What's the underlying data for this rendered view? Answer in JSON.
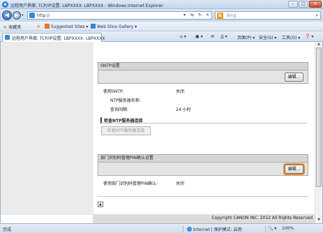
{
  "window": {
    "title": "远程用户界面: TCP/IP设置: LBPXXXX: LBPXXXX - Windows Internet Explorer",
    "minimize": "–",
    "maximize": "□",
    "close": "✕"
  },
  "address_bar": {
    "url": "http://",
    "search_placeholder": "Bing",
    "back_glyph": "◀",
    "forward_glyph": "▶",
    "refresh_glyph": "↻",
    "stop_glyph": "✕",
    "search_glyph": "⌕"
  },
  "favorites_bar": {
    "favorites": "收藏夹",
    "suggested_sites": "Suggested Sites ▾",
    "web_slice_gallery": "Web Slice Gallery ▾"
  },
  "tab": {
    "label": "远程用户界面: TCP/IP设置: LBPXXXX: LBPXXXX"
  },
  "command_bar": {
    "home": "⌂ ▾",
    "feeds": "▣ ▾",
    "mail": "✉",
    "print": "⎙ ▾",
    "page": "页面(P) ▾",
    "safety": "安全(S) ▾",
    "tools": "工具(O) ▾",
    "help": "❓ ▾"
  },
  "sntp": {
    "header": "SNTP设置",
    "edit_label": "编辑...",
    "use_sntp_label": "使用SNTP:",
    "use_sntp_value": "关闭",
    "server_name_label": "NTP服务器名称:",
    "server_name_value": "",
    "interval_label": "查询间隔:",
    "interval_value": "24 小时"
  },
  "ntp_check": {
    "header": "检查NTP服务器连接",
    "button_label": "检查NTP服务器连接"
  },
  "pin": {
    "header": "部门识别码管理PIN确认设置",
    "edit_label": "编辑...",
    "use_label": "使用部门识别码管理PIN确认:",
    "use_value": "关闭"
  },
  "footer": {
    "to_top": "▲",
    "copyright": "Copyright CANON INC. 2012 All Rights Reserved"
  },
  "status_bar": {
    "status_text": "完成",
    "zone": "Internet | 保护模式: 启用",
    "zoom": "100%",
    "zoom_glyph": "🔍 ▾"
  }
}
